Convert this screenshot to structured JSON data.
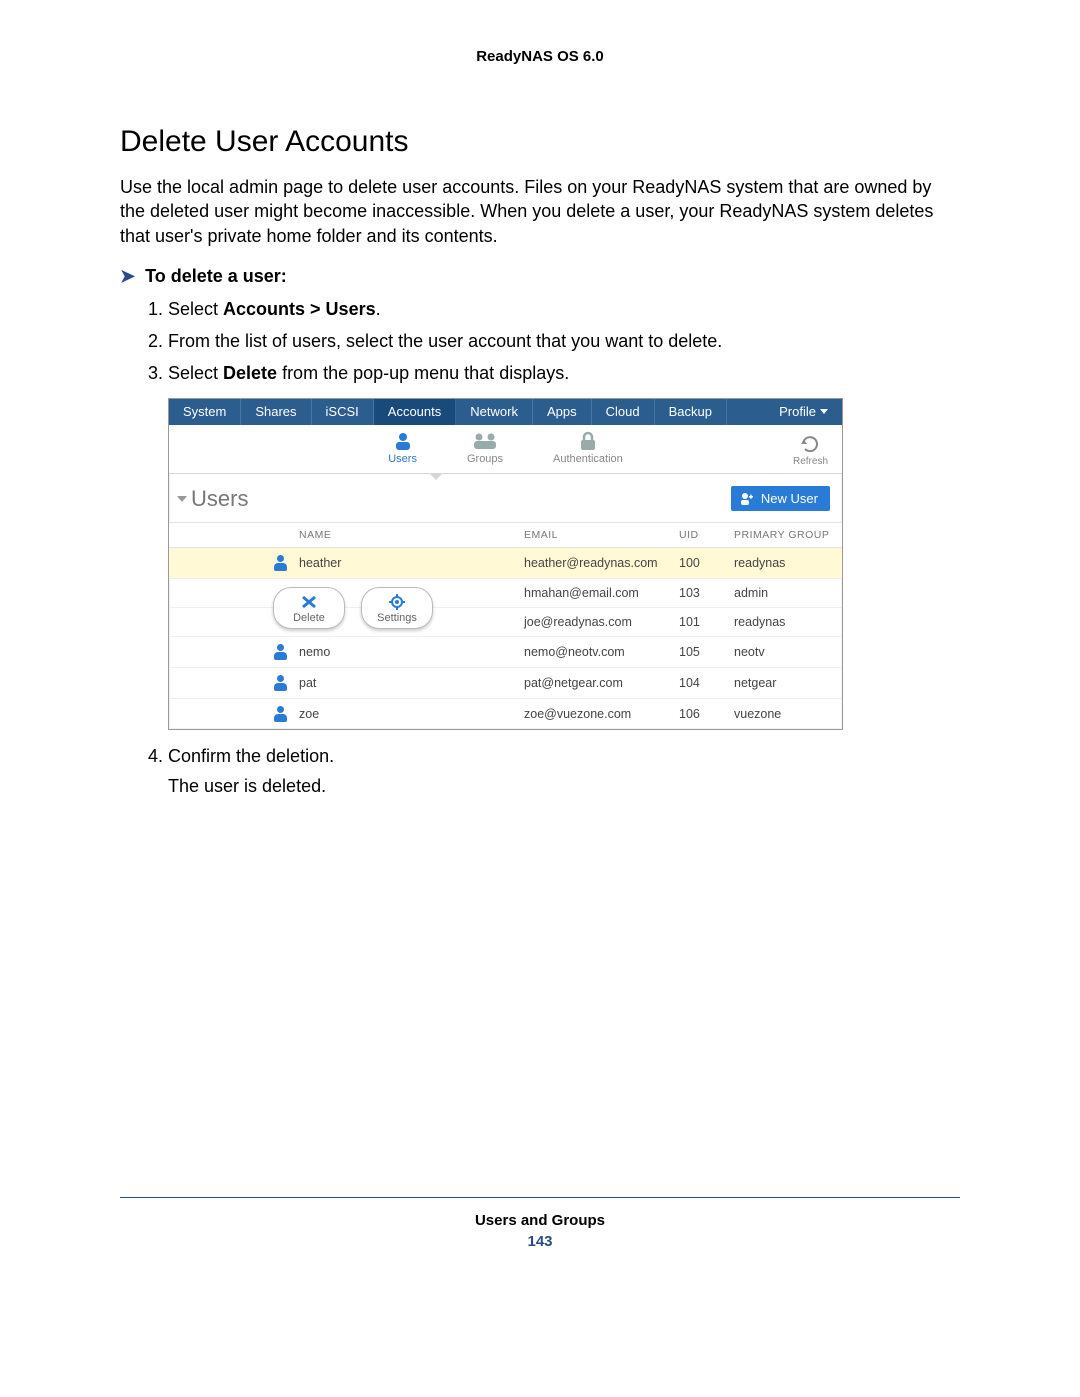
{
  "doc_header": "ReadyNAS OS 6.0",
  "section_title": "Delete User Accounts",
  "intro_text": "Use the local admin page to delete user accounts. Files on your ReadyNAS system that are owned by the deleted user might become inaccessible. When you delete a user, your ReadyNAS system deletes that user's private home folder and its contents.",
  "procedure_title": "To delete a user:",
  "steps": {
    "s1_pre": "Select ",
    "s1_bold": "Accounts > Users",
    "s1_post": ".",
    "s2": "From the list of users, select the user account that you want to delete.",
    "s3_pre": "Select ",
    "s3_bold": "Delete",
    "s3_post": " from the pop-up menu that displays.",
    "s4": "Confirm the deletion."
  },
  "result_text": "The user is deleted.",
  "ui": {
    "tabs": [
      "System",
      "Shares",
      "iSCSI",
      "Accounts",
      "Network",
      "Apps",
      "Cloud",
      "Backup"
    ],
    "selected_tab": "Accounts",
    "profile_label": "Profile",
    "subnav": {
      "users": "Users",
      "groups": "Groups",
      "auth": "Authentication",
      "refresh": "Refresh"
    },
    "section_label": "Users",
    "new_user_label": "New User",
    "columns": {
      "name": "NAME",
      "email": "EMAIL",
      "uid": "UID",
      "group": "PRIMARY GROUP"
    },
    "rows": [
      {
        "name": "heather",
        "email": "heather@readynas.com",
        "uid": "100",
        "group": "readynas",
        "selected": true
      },
      {
        "name": "",
        "email": "hmahan@email.com",
        "uid": "103",
        "group": "admin"
      },
      {
        "name": "",
        "email": "joe@readynas.com",
        "uid": "101",
        "group": "readynas"
      },
      {
        "name": "nemo",
        "email": "nemo@neotv.com",
        "uid": "105",
        "group": "neotv"
      },
      {
        "name": "pat",
        "email": "pat@netgear.com",
        "uid": "104",
        "group": "netgear"
      },
      {
        "name": "zoe",
        "email": "zoe@vuezone.com",
        "uid": "106",
        "group": "vuezone"
      }
    ],
    "popup": {
      "delete": "Delete",
      "settings": "Settings"
    }
  },
  "footer": {
    "title": "Users and Groups",
    "page": "143"
  }
}
